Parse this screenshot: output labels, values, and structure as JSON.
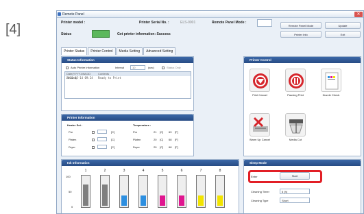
{
  "step_label": "[4]",
  "window": {
    "title": "Remote Panel",
    "close_label": "✕"
  },
  "header": {
    "printer_model_label": "Printer model :",
    "printer_serial_label": "Printer Serial No. :",
    "printer_serial_value": "ELS-0001",
    "remote_panel_mode_label": "Remote Panel Mode :",
    "status_label": "Status",
    "status_color": "#5cb85c",
    "status_message": "Get printer information: Success",
    "remote_panel_mode_button": "Remote Panel Mode",
    "update_button": "Update",
    "printer_info_button": "Printer Info",
    "exit_button": "Exit"
  },
  "tabs": [
    {
      "label": "Printer Status",
      "active": true
    },
    {
      "label": "Printer Control",
      "active": false
    },
    {
      "label": "Media Setting",
      "active": false
    },
    {
      "label": "Advanced Setting",
      "active": false
    }
  ],
  "status_info": {
    "title": "Status Information",
    "auto_printer_info": "Auto Printer Information",
    "interval_label": "Interval",
    "interval_value": "10",
    "interval_unit": "(sec)",
    "status_only": "Status Only",
    "log_headers": [
      "Date(YYYY-MM-DD HH:MM)",
      "Contents"
    ],
    "log_rows": [
      [
        "2013-05-14 09:24",
        "Ready to Print"
      ]
    ]
  },
  "printer_info": {
    "title": "Printer Information",
    "heater_set_label": "Heater Set :",
    "temperature_label": "Temperature :",
    "rows": [
      {
        "name": "Pre",
        "set_unit": "[C]",
        "temp_c": "21",
        "temp_f": "69"
      },
      {
        "name": "Platen",
        "set_unit": "[C]",
        "temp_c": "20",
        "temp_f": "68"
      },
      {
        "name": "Dryer",
        "set_unit": "[C]",
        "temp_c": "20",
        "temp_f": "68"
      }
    ],
    "unit_c": "[C]",
    "unit_f": "[F]"
  },
  "ink_info": {
    "title": "Ink Information",
    "axis": [
      "100",
      "50",
      "0"
    ],
    "slots": [
      {
        "num": "1",
        "color": "#7f7f7f",
        "level": 0.7
      },
      {
        "num": "2",
        "color": "#7f7f7f",
        "level": 0.7
      },
      {
        "num": "3",
        "color": "#2d8fe0",
        "level": 0.35
      },
      {
        "num": "4",
        "color": "#2d8fe0",
        "level": 0.35
      },
      {
        "num": "5",
        "color": "#e0168f",
        "level": 0.35
      },
      {
        "num": "6",
        "color": "#e0168f",
        "level": 0.35
      },
      {
        "num": "7",
        "color": "#f2e400",
        "level": 0.35
      },
      {
        "num": "8",
        "color": "#f2e400",
        "level": 0.35
      }
    ]
  },
  "printer_control": {
    "title": "Printer Control",
    "items": [
      {
        "label": "Print Cancel"
      },
      {
        "label": "Pausing Print"
      },
      {
        "label": "Nozzle Check"
      },
      {
        "label": "Warm Up Cancel"
      },
      {
        "label": "Media Cut"
      }
    ]
  },
  "sleep_mode": {
    "title": "Sleep Mode",
    "enter_label": "Enter",
    "start_button": "Start",
    "cleaning_timer_label": "Cleaning Timer",
    "cleaning_timer_value": "6 (h)",
    "cleaning_type_label": "Cleaning Type",
    "cleaning_type_value": "Short",
    "highlight_color": "#e21f26"
  }
}
